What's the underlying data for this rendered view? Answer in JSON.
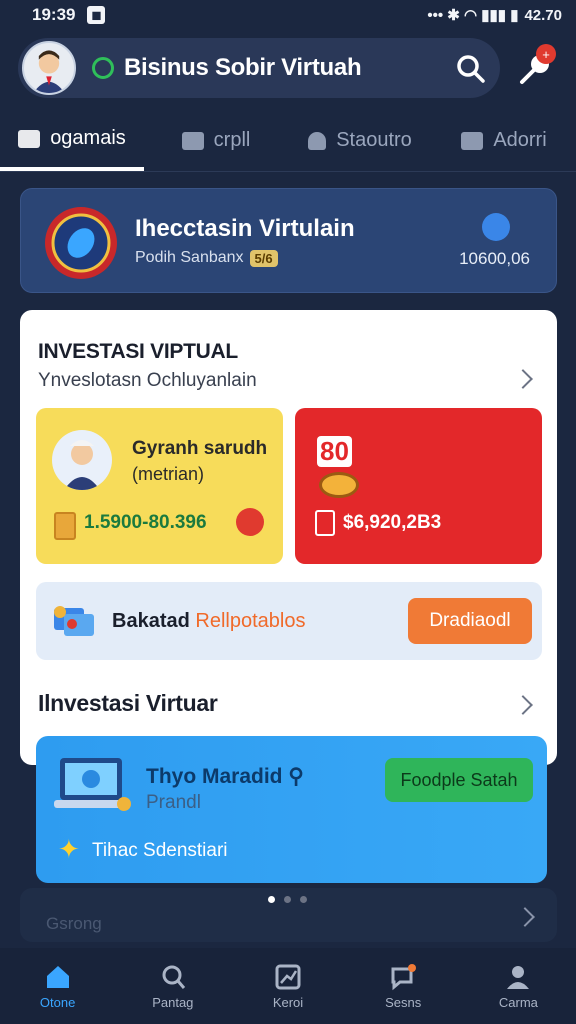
{
  "status_bar": {
    "time": "19:39",
    "battery": "42.70"
  },
  "header": {
    "title": "Bisinus Sobir Virtuah",
    "notification_badge": "+"
  },
  "tabs": [
    {
      "label": "ogamais",
      "active": true
    },
    {
      "label": "crpll",
      "active": false
    },
    {
      "label": "Staoutro",
      "active": false
    },
    {
      "label": "Adorri",
      "active": false
    }
  ],
  "hero": {
    "title": "Ihecctasin Virtulain",
    "subtitle": "Podih Sanbanx",
    "chip": "5/6",
    "value": "10600,06"
  },
  "main": {
    "title": "INVESTASI VIPTUAL",
    "subtitle": "Ynveslotasn Ochluyanlain",
    "card_yellow": {
      "title": "Gyranh sarudh",
      "subtitle": "(metrian)",
      "value": "1.5900-80.396"
    },
    "card_red": {
      "number": "80",
      "value": "$6,920,2B3"
    },
    "banner": {
      "text_bold": "Bakatad",
      "text_highlight": "Rellpotablos",
      "button": "Dradiaodl"
    },
    "section_title": "Ilnvestasi Virtuar"
  },
  "promo": {
    "title": "Thyo Maradid",
    "subtitle": "Prandl",
    "button": "Foodple Satah",
    "footer": "Tihac Sdenstiari"
  },
  "footer_card": {
    "label": "Gsrong"
  },
  "bottom_nav": [
    {
      "label": "Otone",
      "icon": "home-icon",
      "active": true
    },
    {
      "label": "Pantag",
      "icon": "search-icon",
      "active": false
    },
    {
      "label": "Keroi",
      "icon": "chart-icon",
      "active": false
    },
    {
      "label": "Sesns",
      "icon": "chat-icon",
      "active": false
    },
    {
      "label": "Carma",
      "icon": "profile-icon",
      "active": false
    }
  ],
  "colors": {
    "accent": "#3aa6ff",
    "background": "#1b2740",
    "card_yellow": "#f7dc5a",
    "card_red": "#e3282a",
    "promo": "#2e9cf0",
    "button_orange": "#f07a36",
    "button_green": "#2fb55a"
  }
}
